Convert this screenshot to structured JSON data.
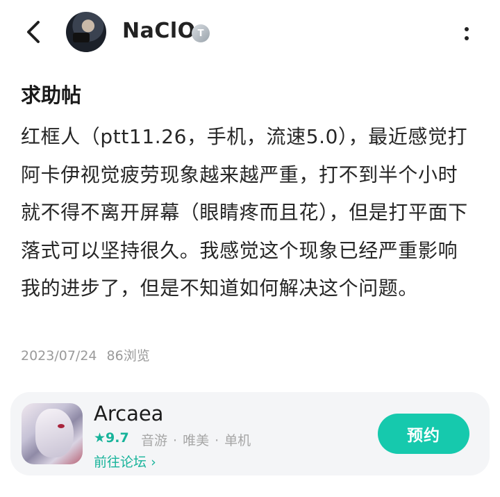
{
  "header": {
    "back_icon": "chevron-left-icon",
    "username": "NaClO",
    "badge": "T",
    "more_icon": "vertical-dots-icon"
  },
  "post": {
    "title": "求助帖",
    "body": "红框人（ptt11.26，手机，流速5.0），最近感觉打阿卡伊视觉疲劳现象越来越严重，打不到半个小时就不得不离开屏幕（眼睛疼而且花），但是打平面下落式可以坚持很久。我感觉这个现象已经严重影响我的进步了，但是不知道如何解决这个问题。",
    "date": "2023/07/24",
    "views": "86浏览"
  },
  "app_card": {
    "name": "Arcaea",
    "rating_star": "★",
    "rating": "9.7",
    "tags": [
      "音游",
      "唯美",
      "单机"
    ],
    "forum_link": "前往论坛",
    "forum_arrow": "›",
    "reserve_label": "预约",
    "accent_color": "#16c9ad"
  }
}
